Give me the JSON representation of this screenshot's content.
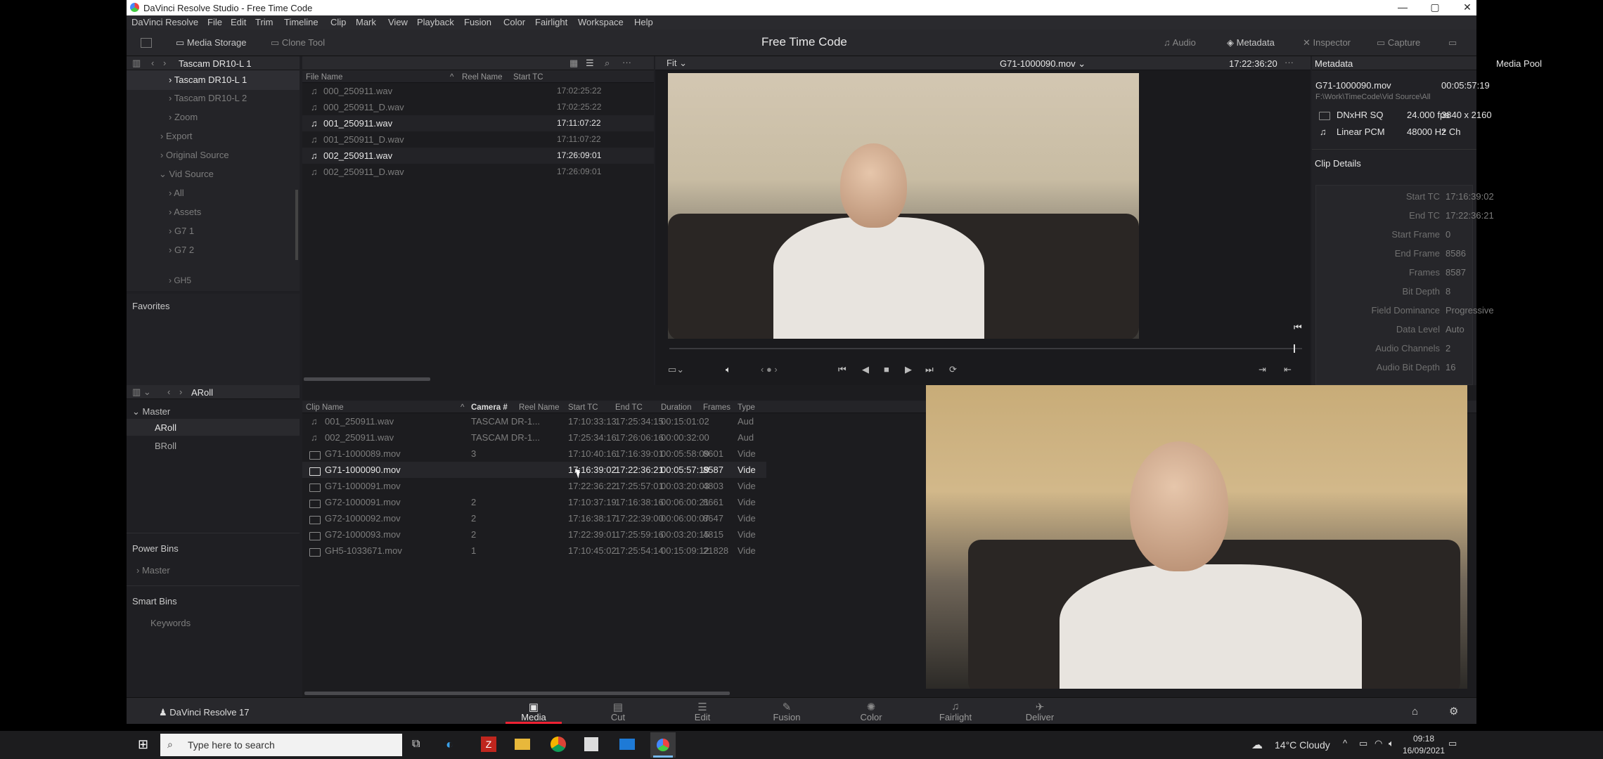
{
  "window": {
    "title": "DaVinci Resolve Studio - Free Time Code"
  },
  "menu": [
    "DaVinci Resolve",
    "File",
    "Edit",
    "Trim",
    "Timeline",
    "Clip",
    "Mark",
    "View",
    "Playback",
    "Fusion",
    "Color",
    "Fairlight",
    "Workspace",
    "Help"
  ],
  "toolbar": {
    "media_storage": "Media Storage",
    "clone_tool": "Clone Tool",
    "project_title": "Free Time Code",
    "audio": "Audio",
    "metadata": "Metadata",
    "inspector": "Inspector",
    "capture": "Capture"
  },
  "storage": {
    "title": "Tascam DR10-L 1",
    "tree": [
      {
        "label": "Tascam DR10-L 1",
        "state": "selected",
        "level": 2
      },
      {
        "label": "Tascam DR10-L 2",
        "state": "dim",
        "level": 2
      },
      {
        "label": "Zoom",
        "state": "dim",
        "level": 2
      },
      {
        "label": "Export",
        "state": "dim",
        "level": 1
      },
      {
        "label": "Original Source",
        "state": "dim",
        "level": 1
      },
      {
        "label": "Vid Source",
        "state": "dim",
        "level": 1,
        "expanded": true
      },
      {
        "label": "All",
        "state": "dim",
        "level": 2
      },
      {
        "label": "Assets",
        "state": "dim",
        "level": 2
      },
      {
        "label": "G7 1",
        "state": "dim",
        "level": 2
      },
      {
        "label": "G7 2",
        "state": "dim",
        "level": 2
      },
      {
        "label": "GH5",
        "state": "dim",
        "level": 2
      }
    ],
    "favorites": "Favorites"
  },
  "files": {
    "columns": [
      "File Name",
      "Reel Name",
      "Start TC"
    ],
    "rows": [
      {
        "name": "000_250911.wav",
        "tc": "17:02:25:22",
        "bright": false
      },
      {
        "name": "000_250911_D.wav",
        "tc": "17:02:25:22",
        "bright": false
      },
      {
        "name": "001_250911.wav",
        "tc": "17:11:07:22",
        "bright": true
      },
      {
        "name": "001_250911_D.wav",
        "tc": "17:11:07:22",
        "bright": false
      },
      {
        "name": "002_250911.wav",
        "tc": "17:26:09:01",
        "bright": true
      },
      {
        "name": "002_250911_D.wav",
        "tc": "17:26:09:01",
        "bright": false
      }
    ]
  },
  "viewer": {
    "fit": "Fit",
    "clip": "G71-1000090.mov",
    "timecode": "17:22:36:20"
  },
  "metadata": {
    "title": "Metadata",
    "pool": "Media Pool",
    "clip": "G71-1000090.mov",
    "duration": "00:05:57:19",
    "path": "F:\\Work\\TimeCode\\Vid Source\\All",
    "codec": "DNxHR SQ",
    "fps": "24.000 fps",
    "resolution": "3840 x 2160",
    "audio_codec": "Linear PCM",
    "sample_rate": "48000 Hz",
    "channels": "2 Ch",
    "clip_details": "Clip Details",
    "details": [
      {
        "label": "Start TC",
        "value": "17:16:39:02"
      },
      {
        "label": "End TC",
        "value": "17:22:36:21"
      },
      {
        "label": "Start Frame",
        "value": "0"
      },
      {
        "label": "End Frame",
        "value": "8586"
      },
      {
        "label": "Frames",
        "value": "8587"
      },
      {
        "label": "Bit Depth",
        "value": "8"
      },
      {
        "label": "Field Dominance",
        "value": "Progressive"
      },
      {
        "label": "Data Level",
        "value": "Auto"
      },
      {
        "label": "Audio Channels",
        "value": "2"
      },
      {
        "label": "Audio Bit Depth",
        "value": "16"
      }
    ]
  },
  "bins": {
    "current": "ARoll",
    "master": "Master",
    "items": [
      "ARoll",
      "BRoll"
    ],
    "power_bins": "Power Bins",
    "power_master": "Master",
    "smart_bins": "Smart Bins",
    "keywords": "Keywords"
  },
  "clips": {
    "columns": [
      "Clip Name",
      "Camera #",
      "Reel Name",
      "Start TC",
      "End TC",
      "Duration",
      "Frames",
      "Type"
    ],
    "rows": [
      {
        "icon": "audio",
        "name": "001_250911.wav",
        "cam": "TASCAM DR-1...",
        "start": "17:10:33:13",
        "end": "17:25:34:15",
        "dur": "00:15:01:02",
        "frames": "",
        "type": "Aud",
        "bright": false
      },
      {
        "icon": "audio",
        "name": "002_250911.wav",
        "cam": "TASCAM DR-1...",
        "start": "17:25:34:16",
        "end": "17:26:06:16",
        "dur": "00:00:32:00",
        "frames": "",
        "type": "Aud",
        "bright": false
      },
      {
        "icon": "video",
        "name": "G71-1000089.mov",
        "cam": "3",
        "start": "17:10:40:16",
        "end": "17:16:39:01",
        "dur": "00:05:58:09",
        "frames": "8601",
        "type": "Vide",
        "bright": false
      },
      {
        "icon": "video",
        "name": "G71-1000090.mov",
        "cam": "",
        "start": "17:16:39:02",
        "end": "17:22:36:21",
        "dur": "00:05:57:19",
        "frames": "8587",
        "type": "Vide",
        "bright": true
      },
      {
        "icon": "video",
        "name": "G71-1000091.mov",
        "cam": "",
        "start": "17:22:36:22",
        "end": "17:25:57:01",
        "dur": "00:03:20:03",
        "frames": "4803",
        "type": "Vide",
        "bright": false
      },
      {
        "icon": "video",
        "name": "G72-1000091.mov",
        "cam": "2",
        "start": "17:10:37:19",
        "end": "17:16:38:16",
        "dur": "00:06:00:21",
        "frames": "8661",
        "type": "Vide",
        "bright": false
      },
      {
        "icon": "video",
        "name": "G72-1000092.mov",
        "cam": "2",
        "start": "17:16:38:17",
        "end": "17:22:39:00",
        "dur": "00:06:00:07",
        "frames": "8647",
        "type": "Vide",
        "bright": false
      },
      {
        "icon": "video",
        "name": "G72-1000093.mov",
        "cam": "2",
        "start": "17:22:39:01",
        "end": "17:25:59:16",
        "dur": "00:03:20:15",
        "frames": "4815",
        "type": "Vide",
        "bright": false
      },
      {
        "icon": "video",
        "name": "GH5-1033671.mov",
        "cam": "1",
        "start": "17:10:45:02",
        "end": "17:25:54:14",
        "dur": "00:15:09:12",
        "frames": "21828",
        "type": "Vide",
        "bright": false
      }
    ]
  },
  "pages": {
    "brand": "DaVinci Resolve 17",
    "items": [
      "Media",
      "Cut",
      "Edit",
      "Fusion",
      "Color",
      "Fairlight",
      "Deliver"
    ],
    "active": "Media"
  },
  "taskbar": {
    "search_placeholder": "Type here to search",
    "weather": "14°C Cloudy",
    "time": "09:18",
    "date": "16/09/2021"
  }
}
